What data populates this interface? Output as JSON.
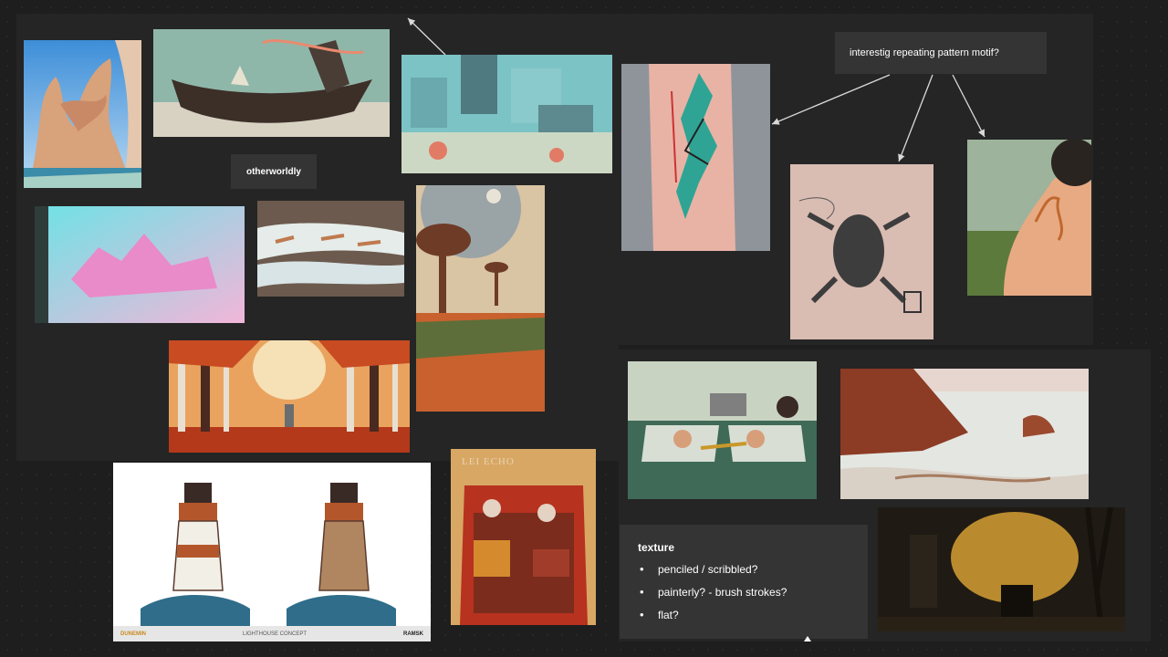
{
  "board": {
    "labels": {
      "otherworldly": "otherworldly",
      "pattern_note": "interestig repeating pattern motif?"
    },
    "texture": {
      "title": "texture",
      "items": [
        "penciled / scribbled?",
        "painterly? - brush strokes?",
        "flat?"
      ]
    }
  },
  "images": {
    "lighthouse_caption": "LIGHTHOUSE CONCEPT",
    "lighthouse_logo_left": "DUNEMIN",
    "lighthouse_logo_right": "RAMSK",
    "car_cover_title": "LEI ECHO"
  },
  "colors": {
    "background": "#1e1e1e",
    "section": "#252525",
    "card": "#343434",
    "arrow": "#d9d9d9"
  }
}
